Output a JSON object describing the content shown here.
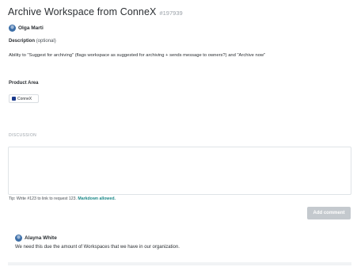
{
  "request": {
    "title": "Archive Workspace from ConneX",
    "id": "#197939",
    "author": "Olga Marti"
  },
  "description": {
    "label": "Description",
    "optional": "(optional)",
    "text": "Ability to \"Suggest for archiving\" (flags workspace as suggested for archiving + sends message to owners?) and \"Archive now\""
  },
  "product_area": {
    "label": "Product Area",
    "tag": "ConneX",
    "tag_color": "#1b3a8c"
  },
  "discussion": {
    "label": "DISCUSSION",
    "input_value": "",
    "tip": "Tip: Write #123 to link to request 123. ",
    "markdown": "Markdown allowed.",
    "add_button": "Add comment"
  },
  "comments": [
    {
      "author": "Alayna White",
      "text": "We need this due the amount of Workspaces that we have in our organization."
    }
  ],
  "colors": {
    "accent_teal": "#1f8a8a",
    "button_disabled": "#c4c9ce"
  }
}
